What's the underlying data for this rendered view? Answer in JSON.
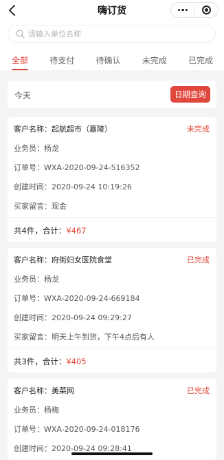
{
  "header": {
    "title": "嗨订货"
  },
  "search": {
    "placeholder": "请输入单位名称"
  },
  "tabs": [
    {
      "label": "全部",
      "active": true
    },
    {
      "label": "待支付"
    },
    {
      "label": "待确认"
    },
    {
      "label": "未完成"
    },
    {
      "label": "已完成"
    }
  ],
  "date_bar": {
    "today_label": "今天",
    "button_label": "日期查询"
  },
  "orders": [
    {
      "customer": "客户名称：起航超市（嘉陵）",
      "status": "未完成",
      "salesman": "业务员：杨龙",
      "order_no": "订单号：WXA-2020-09-24-516352",
      "created": "创建时间：2020-09-24 10:19:26",
      "message": "买家留言：现金",
      "total_label": "共4件，合计：",
      "total_price": "¥467"
    },
    {
      "customer": "客户名称：府街妇女医院食堂",
      "status": "已完成",
      "salesman": "业务员：杨龙",
      "order_no": "订单号：WXA-2020-09-24-669184",
      "created": "创建时间：2020-09-24 09:29:27",
      "message": "买家留言：明天上午到货，下午4点后有人",
      "total_label": "共3件，合计：",
      "total_price": "¥405"
    },
    {
      "customer": "客户名称：美菜网",
      "status": "已完成",
      "salesman": "业务员：杨梅",
      "order_no": "订单号：WXA-2020-09-24-018176",
      "created": "创建时间：2020-09-24 09:28:41"
    }
  ],
  "colors": {
    "accent": "#e04438",
    "background": "#f4f4f4"
  },
  "icons": [
    "back-icon",
    "more-icon",
    "target-icon",
    "search-icon"
  ]
}
